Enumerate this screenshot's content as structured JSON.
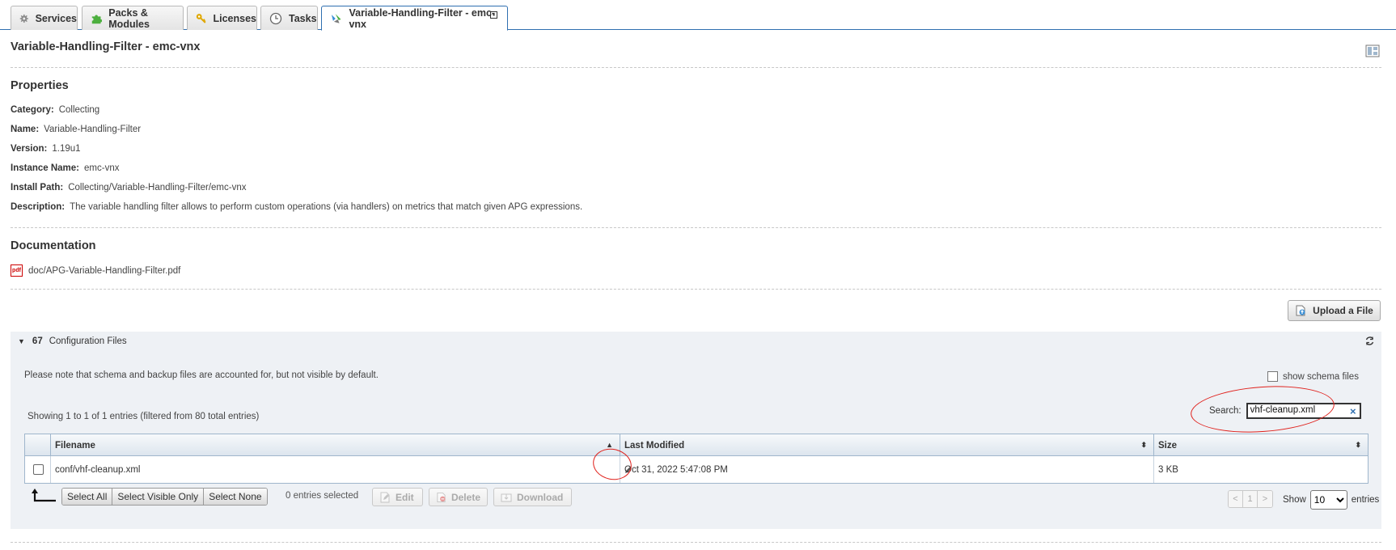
{
  "tabs": [
    {
      "label": "Services",
      "icon": "gear-icon"
    },
    {
      "label": "Packs & Modules",
      "icon": "puzzle-icon"
    },
    {
      "label": "Licenses",
      "icon": "key-icon"
    },
    {
      "label": "Tasks",
      "icon": "clock-icon"
    },
    {
      "label": "Variable-Handling-Filter - emc-vnx",
      "icon": "module-icon",
      "active": true
    }
  ],
  "page": {
    "title": "Variable-Handling-Filter - emc-vnx"
  },
  "properties": {
    "heading": "Properties",
    "items": [
      {
        "label": "Category:",
        "value": "Collecting"
      },
      {
        "label": "Name:",
        "value": "Variable-Handling-Filter"
      },
      {
        "label": "Version:",
        "value": "1.19u1"
      },
      {
        "label": "Instance Name:",
        "value": "emc-vnx"
      },
      {
        "label": "Install Path:",
        "value": "Collecting/Variable-Handling-Filter/emc-vnx"
      },
      {
        "label": "Description:",
        "value": "The variable handling filter allows to perform custom operations (via handlers) on metrics that match given APG expressions."
      }
    ]
  },
  "documentation": {
    "heading": "Documentation",
    "link": "doc/APG-Variable-Handling-Filter.pdf",
    "pdf_icon_text": "pdf"
  },
  "upload_button": "Upload a File",
  "config": {
    "count": "67",
    "title": "Configuration Files",
    "note": "Please note that schema and backup files are accounted for, but not visible by default.",
    "show_schema_label": "show schema files",
    "showing_text": "Showing 1 to 1 of 1 entries (filtered from 80 total entries)",
    "search_label": "Search:",
    "search_value": "vhf-cleanup.xml",
    "search_clear": "×",
    "columns": [
      "Filename",
      "Last Modified",
      "Size"
    ],
    "rows": [
      {
        "filename": "conf/vhf-cleanup.xml",
        "modified": "Oct 31, 2022 5:47:08 PM",
        "size": "3 KB"
      }
    ],
    "select_buttons": [
      "Select All",
      "Select Visible Only",
      "Select None"
    ],
    "entries_selected": "0 entries selected",
    "actions": [
      "Edit",
      "Delete",
      "Download"
    ],
    "pager": {
      "prev": "<",
      "page": "1",
      "next": ">"
    },
    "show_label": "Show",
    "page_size": "10",
    "entries_label": "entries"
  },
  "colors": {
    "tab_border": "#2f6fb0",
    "panel_bg": "#eef1f5",
    "annotation_red": "#e0201b"
  }
}
